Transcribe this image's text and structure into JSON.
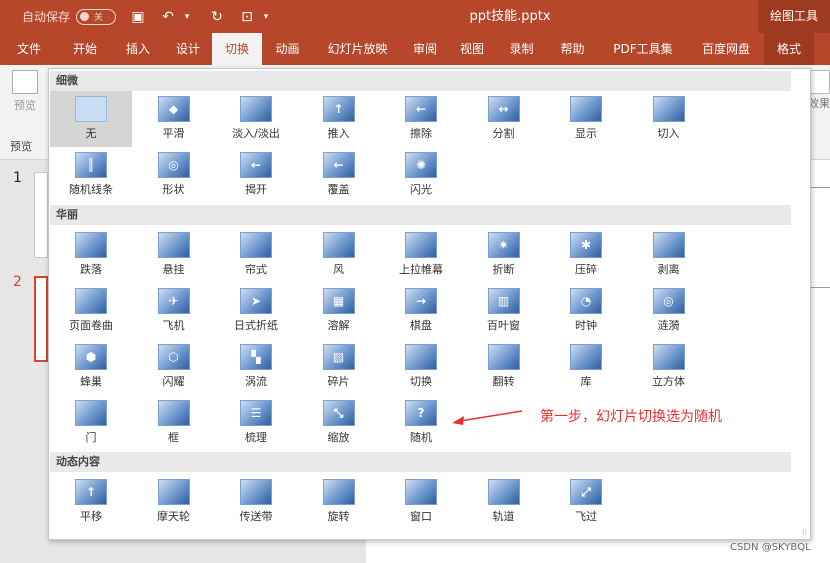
{
  "titlebar": {
    "autosave_label": "自动保存",
    "autosave_state": "关",
    "doc_title": "ppt技能.pptx",
    "tool_title": "绘图工具",
    "icons": [
      "save-icon",
      "undo-icon",
      "undo-dropdown-icon",
      "redo-icon",
      "present-icon",
      "customize-icon"
    ]
  },
  "menu": {
    "tabs": [
      {
        "label": "文件",
        "active": false
      },
      {
        "label": "开始",
        "active": false
      },
      {
        "label": "插入",
        "active": false
      },
      {
        "label": "设计",
        "active": false
      },
      {
        "label": "切换",
        "active": true
      },
      {
        "label": "动画",
        "active": false
      },
      {
        "label": "幻灯片放映",
        "active": false
      },
      {
        "label": "审阅",
        "active": false
      },
      {
        "label": "视图",
        "active": false
      },
      {
        "label": "录制",
        "active": false
      },
      {
        "label": "帮助",
        "active": false
      },
      {
        "label": "PDF工具集",
        "active": false
      },
      {
        "label": "百度网盘",
        "active": false
      },
      {
        "label": "格式",
        "active": false
      }
    ]
  },
  "ribbon": {
    "preview_button_label": "预览",
    "preview_group_label": "预览",
    "effect_options_label": "效果"
  },
  "slides_pane": {
    "numbers": [
      "1",
      "2"
    ]
  },
  "gallery": {
    "sections": [
      {
        "label": "细微",
        "items": [
          {
            "label": "无",
            "glyph": "",
            "selected": true,
            "icon": "none-transition-icon"
          },
          {
            "label": "平滑",
            "glyph": "◆",
            "icon": "morph-transition-icon"
          },
          {
            "label": "淡入/淡出",
            "glyph": "",
            "icon": "fade-transition-icon"
          },
          {
            "label": "推入",
            "glyph": "↑",
            "icon": "push-transition-icon"
          },
          {
            "label": "擦除",
            "glyph": "←",
            "icon": "wipe-transition-icon"
          },
          {
            "label": "分割",
            "glyph": "↔",
            "icon": "split-transition-icon"
          },
          {
            "label": "显示",
            "glyph": "",
            "icon": "reveal-transition-icon"
          },
          {
            "label": "切入",
            "glyph": "",
            "icon": "cut-transition-icon"
          },
          {
            "label": "随机线条",
            "glyph": "║",
            "icon": "random-bars-transition-icon"
          },
          {
            "label": "形状",
            "glyph": "◎",
            "icon": "shape-transition-icon"
          },
          {
            "label": "揭开",
            "glyph": "←",
            "icon": "uncover-transition-icon"
          },
          {
            "label": "覆盖",
            "glyph": "←",
            "icon": "cover-transition-icon"
          },
          {
            "label": "闪光",
            "glyph": "✺",
            "icon": "flash-transition-icon"
          }
        ]
      },
      {
        "label": "华丽",
        "items": [
          {
            "label": "跌落",
            "glyph": "",
            "icon": "fall-over-transition-icon"
          },
          {
            "label": "悬挂",
            "glyph": "",
            "icon": "drape-transition-icon"
          },
          {
            "label": "帘式",
            "glyph": "",
            "icon": "curtains-transition-icon"
          },
          {
            "label": "风",
            "glyph": "",
            "icon": "wind-transition-icon"
          },
          {
            "label": "上拉帷幕",
            "glyph": "",
            "icon": "prestige-transition-icon"
          },
          {
            "label": "折断",
            "glyph": "✷",
            "icon": "fracture-transition-icon"
          },
          {
            "label": "压碎",
            "glyph": "✱",
            "icon": "crush-transition-icon"
          },
          {
            "label": "剥离",
            "glyph": "",
            "icon": "peel-off-transition-icon"
          },
          {
            "label": "页面卷曲",
            "glyph": "",
            "icon": "page-curl-transition-icon"
          },
          {
            "label": "飞机",
            "glyph": "✈",
            "icon": "airplane-transition-icon"
          },
          {
            "label": "日式折纸",
            "glyph": "➤",
            "icon": "origami-transition-icon"
          },
          {
            "label": "溶解",
            "glyph": "▦",
            "icon": "dissolve-transition-icon"
          },
          {
            "label": "棋盘",
            "glyph": "→",
            "icon": "checkerboard-transition-icon"
          },
          {
            "label": "百叶窗",
            "glyph": "▥",
            "icon": "blinds-transition-icon"
          },
          {
            "label": "时钟",
            "glyph": "◔",
            "icon": "clock-transition-icon"
          },
          {
            "label": "涟漪",
            "glyph": "◎",
            "icon": "ripple-transition-icon"
          },
          {
            "label": "蜂巢",
            "glyph": "⬢",
            "icon": "honeycomb-transition-icon"
          },
          {
            "label": "闪耀",
            "glyph": "⬡",
            "icon": "glitter-transition-icon"
          },
          {
            "label": "涡流",
            "glyph": "▚",
            "icon": "vortex-transition-icon"
          },
          {
            "label": "碎片",
            "glyph": "▧",
            "icon": "shred-transition-icon"
          },
          {
            "label": "切换",
            "glyph": "",
            "icon": "switch-transition-icon"
          },
          {
            "label": "翻转",
            "glyph": "",
            "icon": "flip-transition-icon"
          },
          {
            "label": "库",
            "glyph": "",
            "icon": "gallery-transition-icon"
          },
          {
            "label": "立方体",
            "glyph": "",
            "icon": "cube-transition-icon"
          },
          {
            "label": "门",
            "glyph": "",
            "icon": "doors-transition-icon"
          },
          {
            "label": "框",
            "glyph": "",
            "icon": "box-transition-icon"
          },
          {
            "label": "梳理",
            "glyph": "☰",
            "icon": "comb-transition-icon"
          },
          {
            "label": "缩放",
            "glyph": "⤡",
            "icon": "zoom-transition-icon"
          },
          {
            "label": "随机",
            "glyph": "?",
            "icon": "random-transition-icon"
          }
        ]
      },
      {
        "label": "动态内容",
        "items": [
          {
            "label": "平移",
            "glyph": "↑",
            "icon": "pan-transition-icon"
          },
          {
            "label": "摩天轮",
            "glyph": "",
            "icon": "ferris-wheel-transition-icon"
          },
          {
            "label": "传送带",
            "glyph": "",
            "icon": "conveyor-transition-icon"
          },
          {
            "label": "旋转",
            "glyph": "",
            "icon": "rotate-transition-icon"
          },
          {
            "label": "窗口",
            "glyph": "",
            "icon": "window-transition-icon"
          },
          {
            "label": "轨道",
            "glyph": "",
            "icon": "orbit-transition-icon"
          },
          {
            "label": "飞过",
            "glyph": "⤢",
            "icon": "fly-through-transition-icon"
          }
        ]
      }
    ]
  },
  "annotation": {
    "text": "第一步，幻灯片切换选为随机",
    "color": "#e8312f"
  },
  "watermark": "CSDN @SKYBQL",
  "colors": {
    "accent": "#b7472a",
    "annotation": "#e8312f"
  }
}
